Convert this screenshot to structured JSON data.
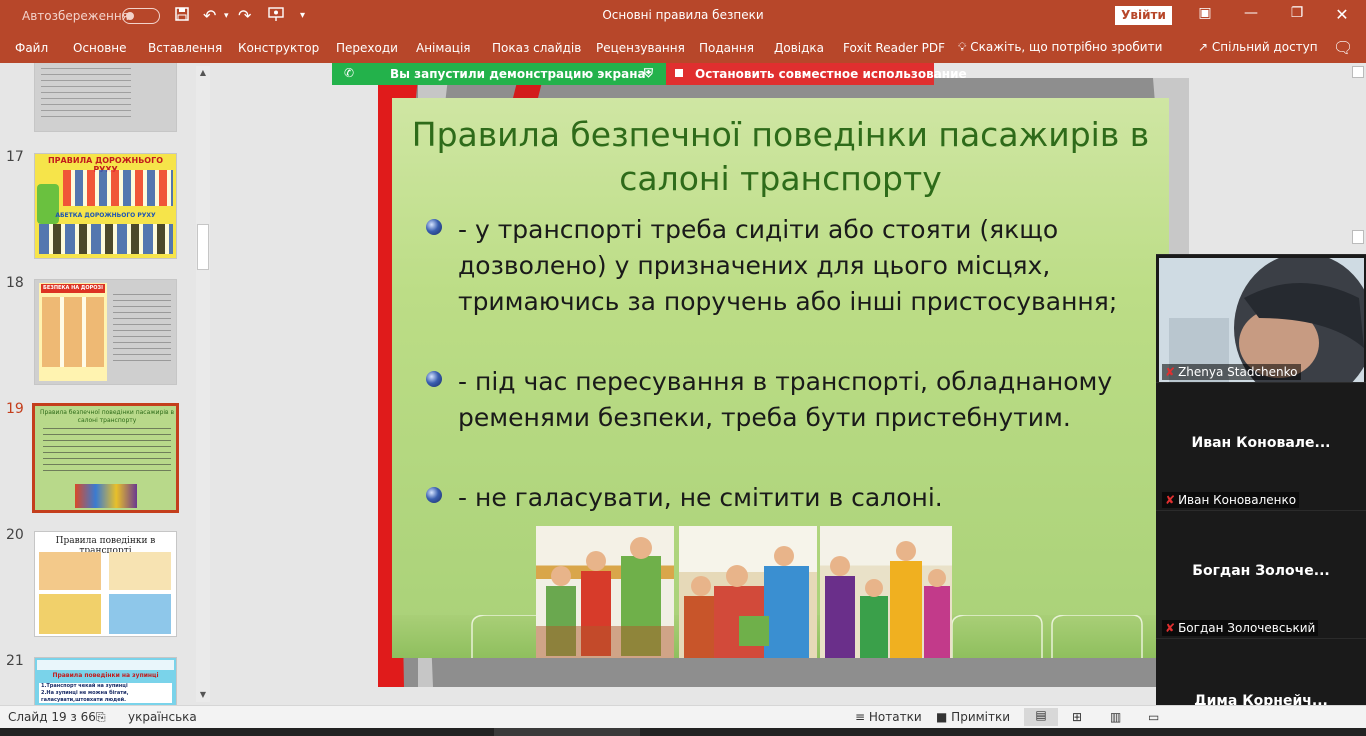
{
  "titlebar": {
    "autosave_label": "Автозбереження",
    "doc_title": "Основні правила безпеки",
    "signin_label": "Увійти",
    "icons": [
      "save-icon",
      "undo-icon",
      "redo-icon",
      "present-icon",
      "customize-icon",
      "ribbon-display-icon",
      "minimize-icon",
      "restore-icon",
      "close-icon"
    ]
  },
  "ribbon": {
    "tabs": [
      "Файл",
      "Основне",
      "Вставлення",
      "Конструктор",
      "Переходи",
      "Анімація",
      "Показ слайдів",
      "Рецензування",
      "Подання",
      "Довідка",
      "Foxit Reader PDF"
    ],
    "tell_me": "Скажіть, що потрібно зробити",
    "share": "Спільний доступ"
  },
  "thumbnails": {
    "numbers": [
      "17",
      "18",
      "19",
      "20",
      "21"
    ],
    "slide17_title": "ПРАВИЛА ДОРОЖНЬОГО РУХУ",
    "slide17_footer": "АБЕТКА ДОРОЖНЬОГО РУХУ",
    "slide18_title": "БЕЗПЕКА НА ДОРОЗІ",
    "slide19_title": "Правила безпечної поведінки пасажирів в салоні транспорту",
    "slide20_title": "Правила поведінки в транспорті",
    "slide21_title": "Правила поведінки на зупинці",
    "slide21_line1": "1.Транспорт чекай на зупинці",
    "slide21_line2": "2.На зупинці не можна бігати, галасувати,штовхати людей."
  },
  "share_banner": {
    "sharing_text": "Вы запустили демонстрацию экрана",
    "stop_text": "Остановить совместное использование"
  },
  "slide": {
    "title": "Правила безпечної поведінки пасажирів в салоні транспорту",
    "bullets": [
      "-   у транспорті треба сидіти або стояти (якщо дозволено) у призначених для цього місцях, тримаючись за поручень або інші пристосування;",
      "-   під час пересування в транспорті, обладнаному ременями безпеки, треба бути пристебнутим.",
      "- не галасувати, не смітити в салоні."
    ]
  },
  "video_panel": {
    "tiles": [
      {
        "big": "",
        "small": "Zhenya Stadchenko"
      },
      {
        "big": "Иван  Коновале...",
        "small": "Иван Коноваленко"
      },
      {
        "big": "Богдан  Золоче...",
        "small": "Богдан Золочевський"
      },
      {
        "big": "Дима  Корнейч...",
        "small": ""
      }
    ]
  },
  "statusbar": {
    "slide_info": "Слайд 19 з 66",
    "language": "українська",
    "notes": "Нотатки",
    "comments": "Примітки"
  },
  "colors": {
    "ppt_accent": "#b7472a",
    "share_green": "#23b24b",
    "stop_red": "#e02f2f",
    "slide_title_green": "#2e6b1a"
  }
}
